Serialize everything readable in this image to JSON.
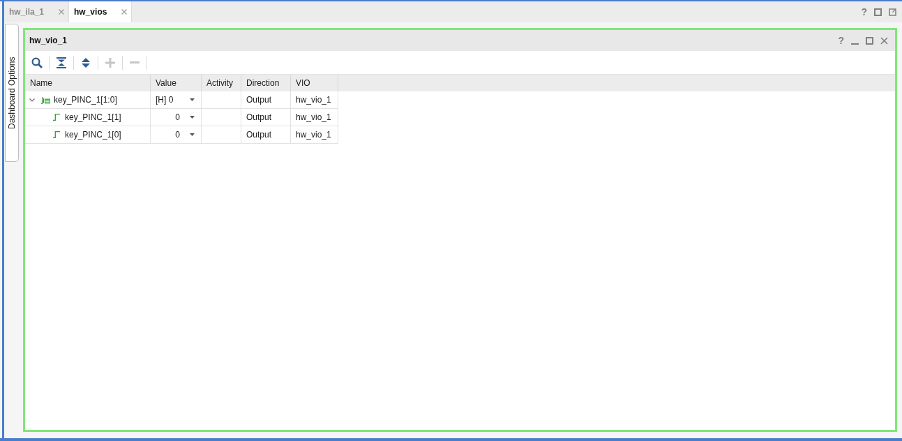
{
  "tab_bar": {
    "tabs": [
      {
        "label": "hw_ila_1",
        "selected": false
      },
      {
        "label": "hw_vios",
        "selected": true
      }
    ],
    "controls": [
      {
        "kind": "help",
        "symbol": "?"
      },
      {
        "kind": "maximize"
      },
      {
        "kind": "float"
      }
    ]
  },
  "side_tab": {
    "label": "Dashboard Options"
  },
  "panel": {
    "title": "hw_vio_1",
    "controls": [
      {
        "kind": "help",
        "symbol": "?"
      },
      {
        "kind": "minimize"
      },
      {
        "kind": "maximize"
      },
      {
        "kind": "close"
      }
    ],
    "toolbar": [
      {
        "kind": "search",
        "disabled": false
      },
      {
        "kind": "collapse_all",
        "disabled": false
      },
      {
        "kind": "expand_all",
        "disabled": false
      },
      {
        "kind": "add",
        "disabled": true
      },
      {
        "kind": "remove",
        "disabled": true
      }
    ],
    "table": {
      "columns": [
        "Name",
        "Value",
        "Activity",
        "Direction",
        "VIO"
      ],
      "rows": [
        {
          "kind": "bus",
          "name": "key_PINC_1[1:0]",
          "expanded": true,
          "value": "[H] 0",
          "direction": "Output",
          "vio": "hw_vio_1",
          "children": [
            {
              "kind": "bit",
              "name": "key_PINC_1[1]",
              "value": "0",
              "direction": "Output",
              "vio": "hw_vio_1"
            },
            {
              "kind": "bit",
              "name": "key_PINC_1[0]",
              "value": "0",
              "direction": "Output",
              "vio": "hw_vio_1"
            }
          ]
        }
      ]
    }
  }
}
